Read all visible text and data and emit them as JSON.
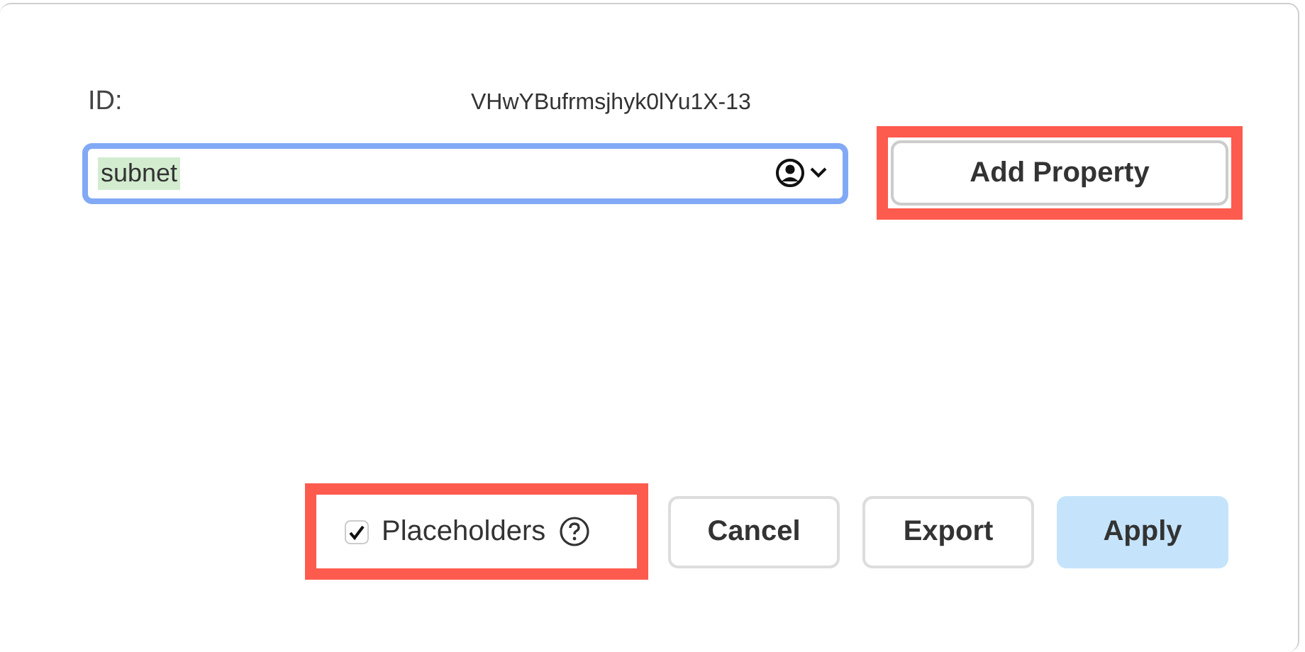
{
  "id_row": {
    "label": "ID:",
    "value": "VHwYBufrmsjhyk0lYu1X-13"
  },
  "property_field": {
    "value": "subnet",
    "value_highlighted": true
  },
  "add_property_button": {
    "label": "Add Property",
    "highlighted": true
  },
  "placeholders_checkbox": {
    "label": "Placeholders",
    "checked": true,
    "highlighted": true
  },
  "buttons": [
    {
      "label": "Cancel",
      "kind": "plain"
    },
    {
      "label": "Export",
      "kind": "plain"
    },
    {
      "label": "Apply",
      "kind": "primary"
    }
  ]
}
